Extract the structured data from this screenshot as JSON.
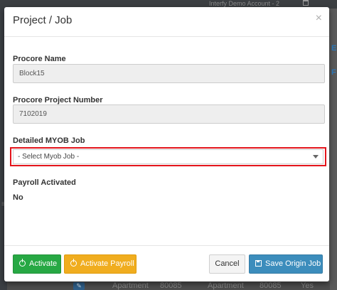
{
  "background": {
    "account_label": "Interfy Demo Account - 2",
    "right_letters": [
      "E",
      "F"
    ],
    "row": {
      "col1": "Apartment",
      "col2": "80085",
      "col3": "Apartment",
      "col4": "80085",
      "col5": "Yes"
    }
  },
  "modal": {
    "title": "Project / Job",
    "close_symbol": "×",
    "fields": {
      "procore_name": {
        "label": "Procore Name",
        "value": "Block15"
      },
      "procore_project_number": {
        "label": "Procore Project Number",
        "value": "7102019"
      },
      "detailed_myob_job": {
        "label": "Detailed MYOB Job",
        "selected": "- Select Myob Job -"
      },
      "payroll_activated": {
        "label": "Payroll Activated",
        "value": "No"
      }
    },
    "buttons": {
      "activate": "Activate",
      "activate_payroll": "Activate Payroll",
      "cancel": "Cancel",
      "save_origin_job": "Save Origin Job"
    }
  },
  "colors": {
    "activate": "#27a844",
    "activate_payroll": "#f0ad1f",
    "save": "#3c8dbc",
    "highlight": "#e3141b"
  }
}
